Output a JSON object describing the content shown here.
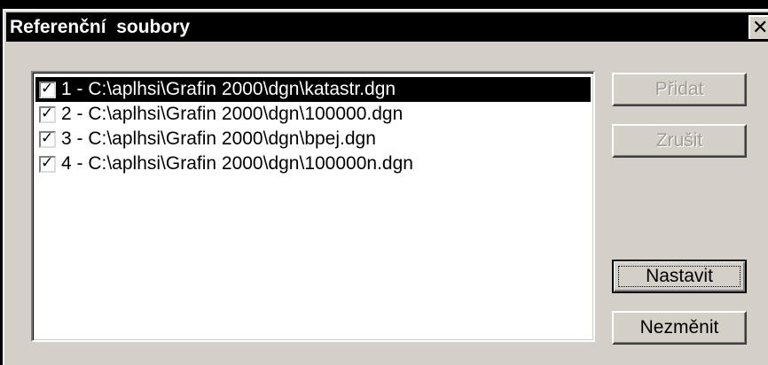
{
  "window": {
    "title": "Referenční  soubory",
    "close_label": "✕"
  },
  "files": [
    {
      "label": "1 - C:\\aplhsi\\Grafin 2000\\dgn\\katastr.dgn",
      "checked": true,
      "selected": true
    },
    {
      "label": "2 - C:\\aplhsi\\Grafin 2000\\dgn\\100000.dgn",
      "checked": true,
      "selected": false
    },
    {
      "label": "3 - C:\\aplhsi\\Grafin 2000\\dgn\\bpej.dgn",
      "checked": true,
      "selected": false
    },
    {
      "label": "4 - C:\\aplhsi\\Grafin 2000\\dgn\\100000n.dgn",
      "checked": true,
      "selected": false
    }
  ],
  "buttons": {
    "add": {
      "label": "Přidat",
      "enabled": false
    },
    "remove": {
      "label": "Zrušit",
      "enabled": false
    },
    "set": {
      "label": "Nastavit",
      "enabled": true
    },
    "cancel": {
      "label": "Nezměnit",
      "enabled": true
    }
  },
  "checkbox_glyph": "✓"
}
